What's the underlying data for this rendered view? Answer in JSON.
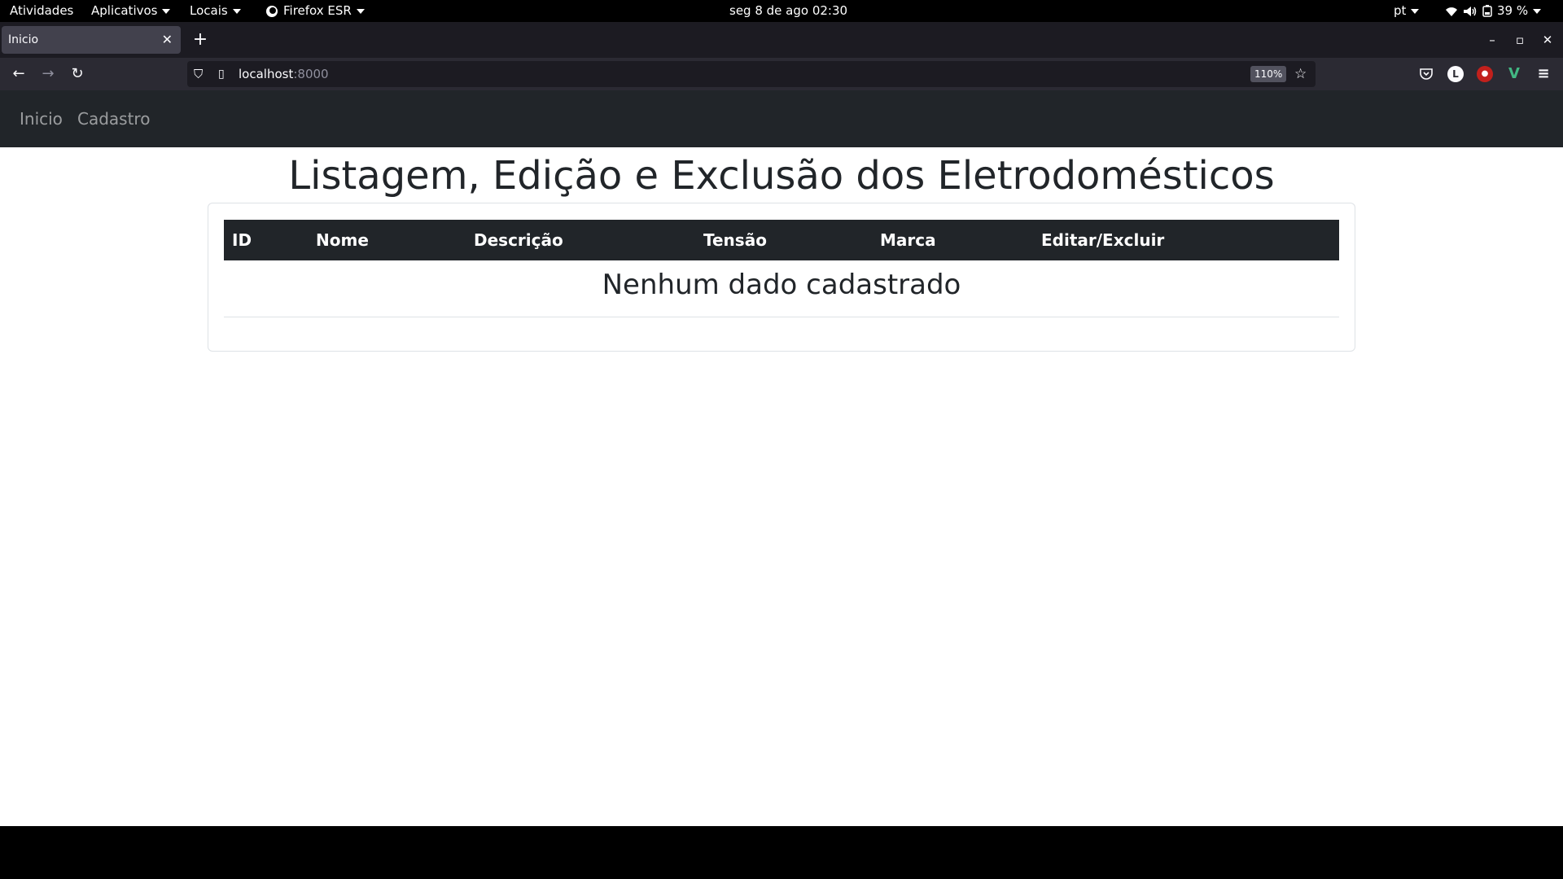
{
  "topbar": {
    "activities": "Atividades",
    "applications": "Aplicativos",
    "places": "Locais",
    "app_name": "Firefox ESR",
    "clock": "seg 8 de ago  02:30",
    "language": "pt",
    "battery": "39 %"
  },
  "browser": {
    "tab_title": "Inicio",
    "url_host": "localhost",
    "url_port": ":8000",
    "zoom": "110%"
  },
  "app": {
    "nav": {
      "home": "Inicio",
      "register": "Cadastro"
    },
    "title": "Listagem, Edição e Exclusão dos Eletrodomésticos",
    "table": {
      "headers": [
        "ID",
        "Nome",
        "Descrição",
        "Tensão",
        "Marca",
        "Editar/Excluir"
      ],
      "empty_message": "Nenhum dado cadastrado"
    }
  },
  "colors": {
    "navbar": "#212529",
    "browser_toolbar": "#2b2a33",
    "tab_strip": "#1c1b22"
  }
}
